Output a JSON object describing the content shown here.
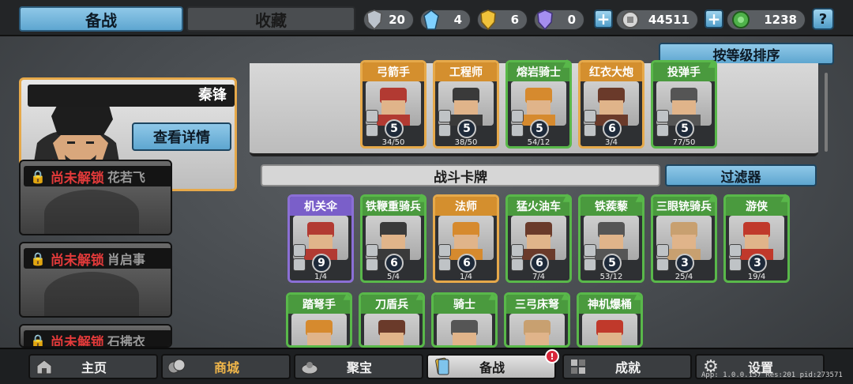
{
  "tabs": {
    "active": "备战",
    "inactive": "收藏"
  },
  "resources": [
    {
      "icon": "silver-shield-icon",
      "value": "20",
      "color": "#bcc3cc"
    },
    {
      "icon": "blue-crystal-icon",
      "value": "4",
      "color": "#7fd0ff"
    },
    {
      "icon": "gold-shield-icon",
      "value": "6",
      "color": "#f0c23a"
    },
    {
      "icon": "purple-shield-icon",
      "value": "0",
      "color": "#a58ef0"
    }
  ],
  "coins": "44511",
  "gems": "1238",
  "sort_label": "按等级排序",
  "hero": {
    "name": "秦锋",
    "detail_label": "查看详情"
  },
  "locked_heroes": [
    {
      "status": "尚未解锁",
      "name": "花若飞"
    },
    {
      "status": "尚未解锁",
      "name": "肖启事"
    },
    {
      "status": "尚未解锁",
      "name": "石拂衣"
    }
  ],
  "deck_cards": [
    {
      "name": "弓箭手",
      "level": "5",
      "count": "34/50",
      "rarity": "orange"
    },
    {
      "name": "工程师",
      "level": "5",
      "count": "38/50",
      "rarity": "orange"
    },
    {
      "name": "熔岩骑士",
      "level": "5",
      "count": "54/12",
      "rarity": "green"
    },
    {
      "name": "红衣大炮",
      "level": "6",
      "count": "3/4",
      "rarity": "orange"
    },
    {
      "name": "投弹手",
      "level": "5",
      "count": "77/50",
      "rarity": "green"
    }
  ],
  "section_title": "战斗卡牌",
  "filter_label": "过滤器",
  "battle_cards": [
    {
      "name": "机关伞",
      "level": "9",
      "count": "1/4",
      "rarity": "purple"
    },
    {
      "name": "铁鞭重骑兵",
      "level": "6",
      "count": "5/4",
      "rarity": "green"
    },
    {
      "name": "法师",
      "level": "6",
      "count": "1/4",
      "rarity": "orange"
    },
    {
      "name": "猛火油车",
      "level": "6",
      "count": "7/4",
      "rarity": "green"
    },
    {
      "name": "铁蒺藜",
      "level": "5",
      "count": "53/12",
      "rarity": "green"
    },
    {
      "name": "三眼铳骑兵",
      "level": "3",
      "count": "25/4",
      "rarity": "green"
    },
    {
      "name": "游侠",
      "level": "3",
      "count": "19/4",
      "rarity": "green"
    }
  ],
  "battle_cards_row2": [
    {
      "name": "踏弩手",
      "rarity": "green"
    },
    {
      "name": "刀盾兵",
      "rarity": "green"
    },
    {
      "name": "骑士",
      "rarity": "green"
    },
    {
      "name": "三弓床弩",
      "rarity": "green"
    },
    {
      "name": "神机爆桶",
      "rarity": "green"
    }
  ],
  "nav": [
    {
      "label": "主页",
      "icon": "home-icon"
    },
    {
      "label": "商城",
      "icon": "coins-icon"
    },
    {
      "label": "聚宝",
      "icon": "treasure-icon"
    },
    {
      "label": "备战",
      "icon": "cards-icon",
      "badge": "!"
    },
    {
      "label": "成就",
      "icon": "achievement-icon"
    },
    {
      "label": "设置",
      "icon": "gear-icon"
    }
  ],
  "version": "App: 1.0.0.157 Res:201 pid:273571"
}
